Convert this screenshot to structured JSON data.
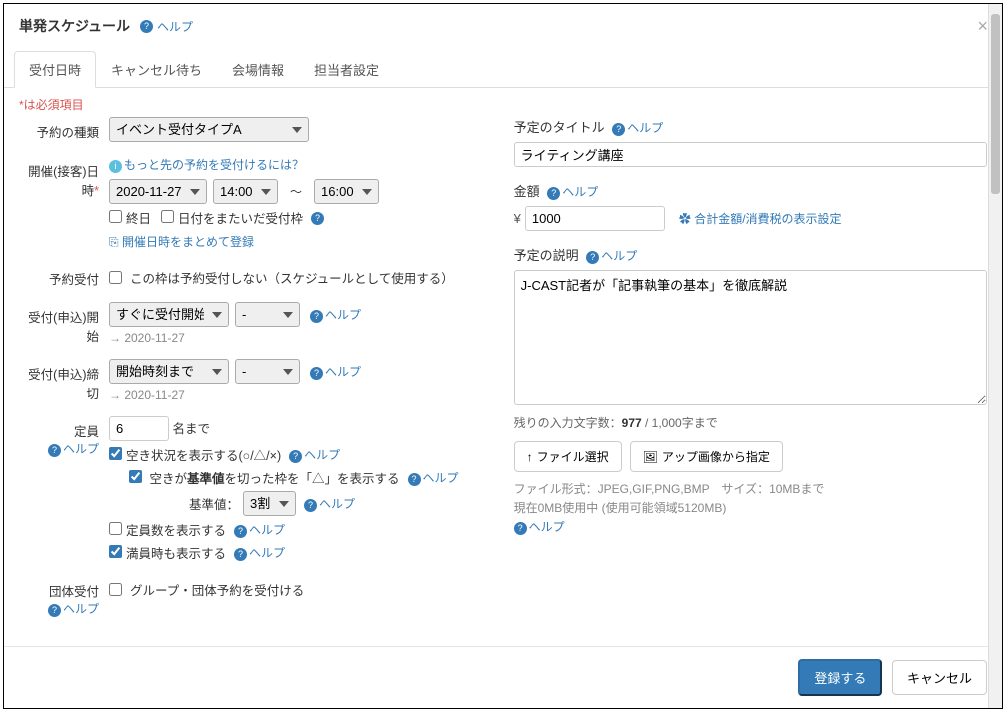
{
  "modal": {
    "title": "単発スケジュール",
    "help": "ヘルプ",
    "close": "×"
  },
  "tabs": [
    "受付日時",
    "キャンセル待ち",
    "会場情報",
    "担当者設定"
  ],
  "required_note": "*は必須項目",
  "left": {
    "type": {
      "label": "予約の種類",
      "value": "イベント受付タイプA"
    },
    "date": {
      "label": "開催(接客)日時",
      "tip": "もっと先の予約を受付けるには？",
      "date_value": "2020-11-27",
      "start": "14:00",
      "end": "16:00",
      "allday": "終日",
      "crossday": "日付をまたいだ受付枠",
      "bulk": "開催日時をまとめて登録"
    },
    "accept": {
      "label": "予約受付",
      "cb": "この枠は予約受付しない（スケジュールとして使用する）"
    },
    "start_accept": {
      "label": "受付(申込)開始",
      "sel1": "すぐに受付開始",
      "sel2": "-",
      "date": "→ 2020-11-27"
    },
    "end_accept": {
      "label": "受付(申込)締切",
      "sel1": "開始時刻まで",
      "sel2": "-",
      "date": "→ 2020-11-27"
    },
    "capacity": {
      "label": "定員",
      "value": "6",
      "unit": "名まで",
      "cb_avail": "空き状況を表示する(○/△/×)",
      "cb_thresh_prefix": "空きが",
      "cb_thresh_bold": "基準値",
      "cb_thresh_suffix": "を切った枠を「△」を表示する",
      "thresh_label": "基準値：",
      "thresh_val": "3割",
      "cb_showcap": "定員数を表示する",
      "cb_full": "満員時も表示する"
    },
    "group": {
      "label": "団体受付",
      "cb": "グループ・団体予約を受付ける"
    }
  },
  "right": {
    "title": {
      "label": "予定のタイトル",
      "value": "ライティング講座"
    },
    "price": {
      "label": "金額",
      "value": "1000",
      "yen": "¥",
      "settings": "合計金額/消費税の表示設定"
    },
    "desc": {
      "label": "予定の説明",
      "value": "J-CAST記者が「記事執筆の基本」を徹底解説"
    },
    "chars": {
      "prefix": "残りの入力文字数：",
      "count": "977",
      "suffix": " / 1,000字まで"
    },
    "upload": {
      "btn1": "ファイル選択",
      "btn2": "アップ画像から指定"
    },
    "file_info1": "ファイル形式：JPEG,GIF,PNG,BMP　サイズ：10MBまで",
    "file_info2": "現在0MB使用中 (使用可能領域5120MB)"
  },
  "footer": {
    "submit": "登録する",
    "cancel": "キャンセル"
  },
  "help": "ヘルプ"
}
